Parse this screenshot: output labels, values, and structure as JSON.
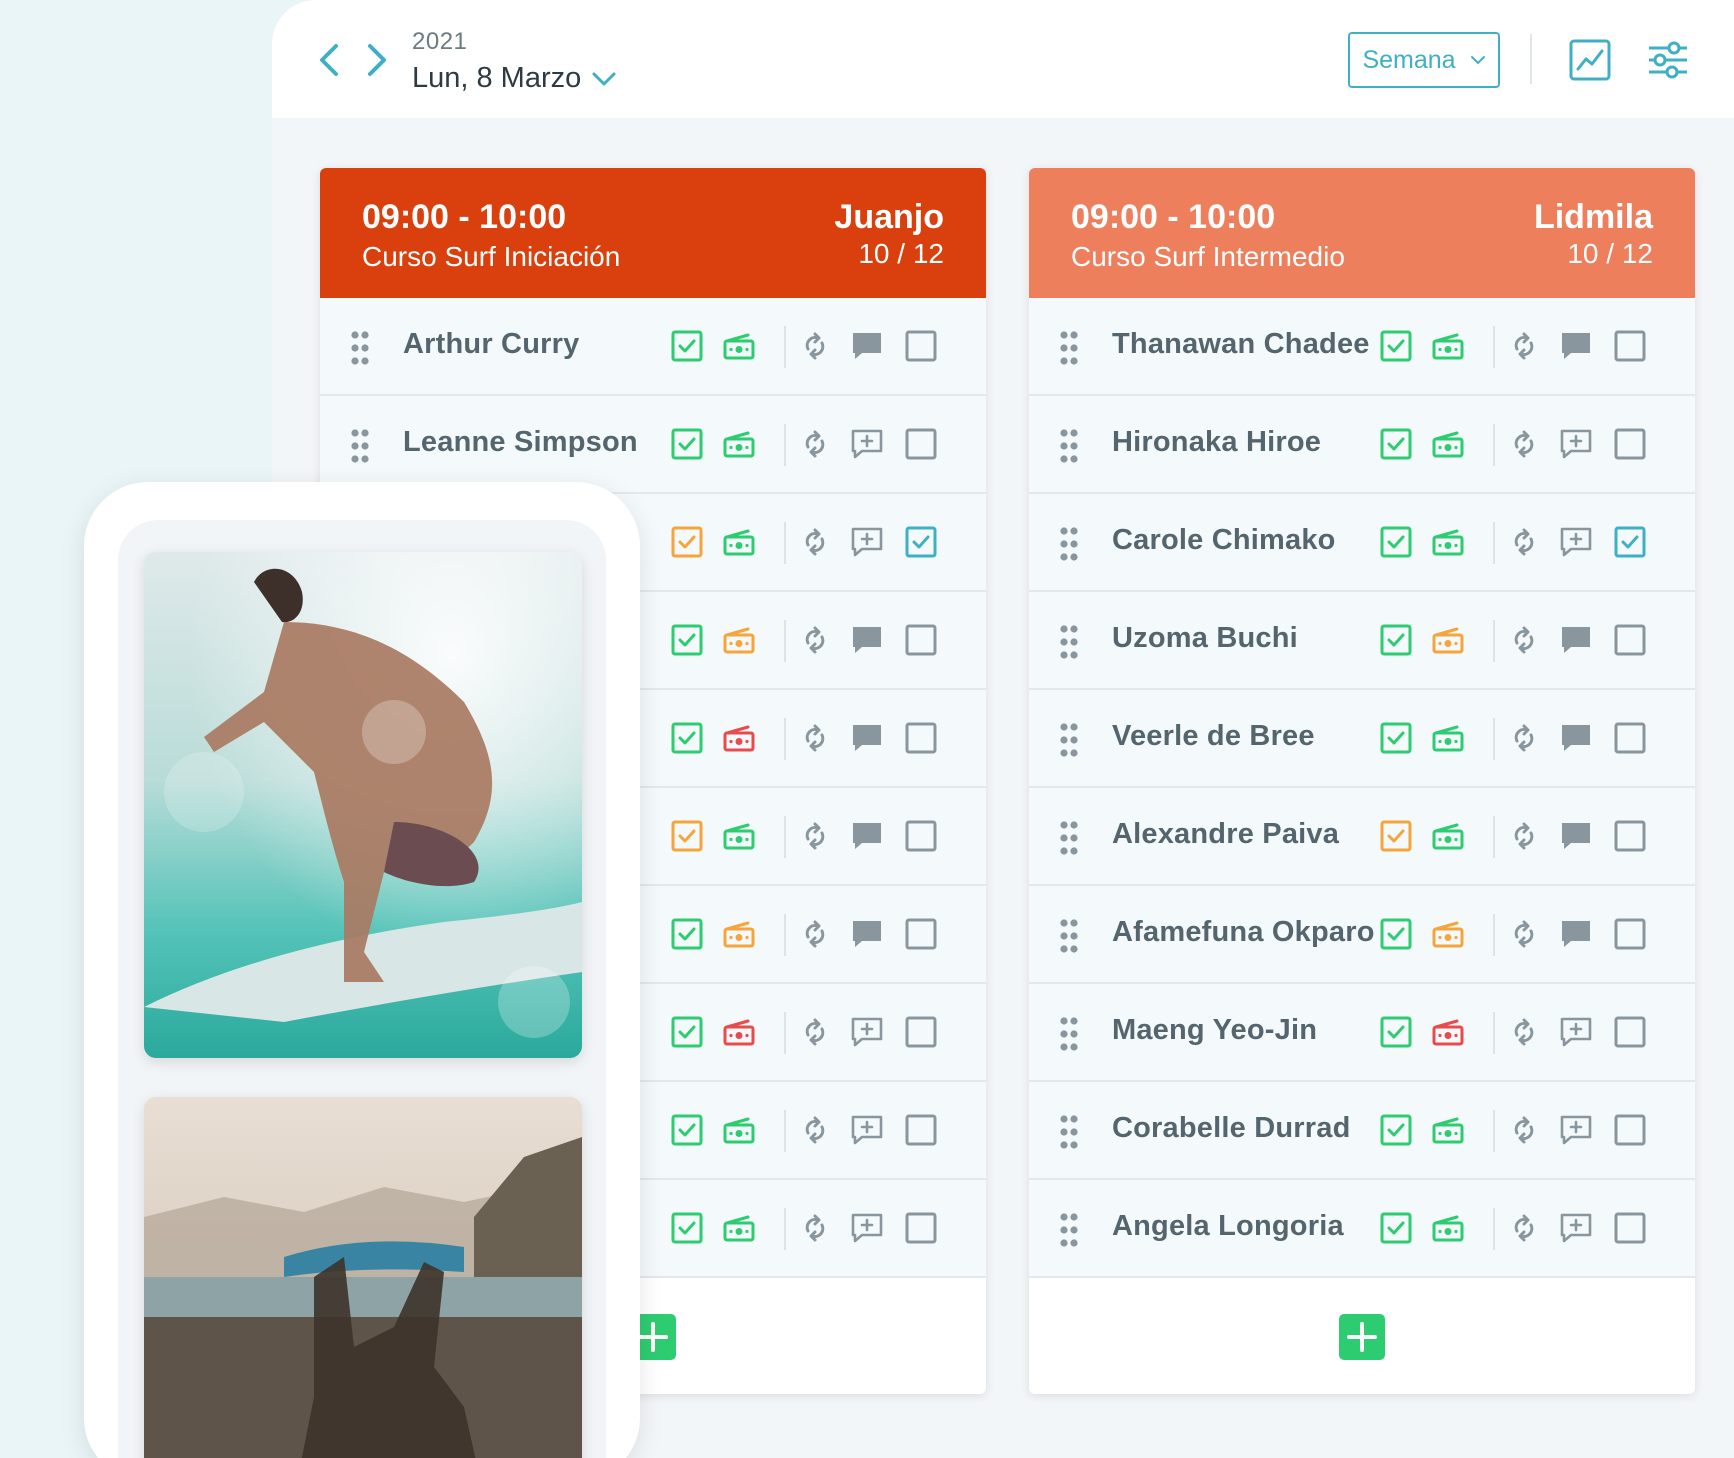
{
  "header": {
    "year": "2021",
    "date": "Lun, 8 Marzo",
    "view_select": "Semana",
    "icons": [
      "chevron-left-icon",
      "chevron-right-icon",
      "chevron-down-icon",
      "chart-icon",
      "filter-sliders-icon"
    ]
  },
  "colors": {
    "accent": "#3fb0c4",
    "card1_header": "#d9400d",
    "card2_header": "#ee7f5c",
    "green": "#2ecc71",
    "orange": "#f5a53b",
    "red": "#e84b4b",
    "gray_icon": "#8a969d"
  },
  "sessions": [
    {
      "time": "09:00 - 10:00",
      "course": "Curso Surf Iniciación",
      "instructor": "Juanjo",
      "count": "10 / 12",
      "students": [
        {
          "name": "Arthur Curry",
          "attendance": "green",
          "payment": "green",
          "comment": "filled",
          "checked": false
        },
        {
          "name": "Leanne Simpson",
          "attendance": "green",
          "payment": "green",
          "comment": "add",
          "checked": false
        },
        {
          "name": "",
          "attendance": "orange",
          "payment": "green",
          "comment": "add",
          "checked": true
        },
        {
          "name": "",
          "attendance": "green",
          "payment": "orange",
          "comment": "filled",
          "checked": false
        },
        {
          "name": "",
          "attendance": "green",
          "payment": "red",
          "comment": "filled",
          "checked": false
        },
        {
          "name": "",
          "attendance": "orange",
          "payment": "green",
          "comment": "filled",
          "checked": false
        },
        {
          "name": "",
          "attendance": "green",
          "payment": "orange",
          "comment": "filled",
          "checked": false
        },
        {
          "name": "",
          "attendance": "green",
          "payment": "red",
          "comment": "add",
          "checked": false
        },
        {
          "name": "",
          "attendance": "green",
          "payment": "green",
          "comment": "add",
          "checked": false
        },
        {
          "name": "",
          "attendance": "green",
          "payment": "green",
          "comment": "add",
          "checked": false
        }
      ]
    },
    {
      "time": "09:00 - 10:00",
      "course": "Curso Surf Intermedio",
      "instructor": "Lidmila",
      "count": "10 / 12",
      "students": [
        {
          "name": "Thanawan Chadee",
          "attendance": "green",
          "payment": "green",
          "comment": "filled",
          "checked": false
        },
        {
          "name": "Hironaka Hiroe",
          "attendance": "green",
          "payment": "green",
          "comment": "add",
          "checked": false
        },
        {
          "name": "Carole Chimako",
          "attendance": "green",
          "payment": "green",
          "comment": "add",
          "checked": true
        },
        {
          "name": "Uzoma Buchi",
          "attendance": "green",
          "payment": "orange",
          "comment": "filled",
          "checked": false
        },
        {
          "name": "Veerle de Bree",
          "attendance": "green",
          "payment": "green",
          "comment": "filled",
          "checked": false
        },
        {
          "name": "Alexandre Paiva",
          "attendance": "orange",
          "payment": "green",
          "comment": "filled",
          "checked": false
        },
        {
          "name": "Afamefuna Okparo",
          "attendance": "green",
          "payment": "orange",
          "comment": "filled",
          "checked": false
        },
        {
          "name": "Maeng Yeo-Jin",
          "attendance": "green",
          "payment": "red",
          "comment": "add",
          "checked": false
        },
        {
          "name": "Corabelle Durrad",
          "attendance": "green",
          "payment": "green",
          "comment": "add",
          "checked": false
        },
        {
          "name": "Angela Longoria",
          "attendance": "green",
          "payment": "green",
          "comment": "add",
          "checked": false
        }
      ]
    }
  ]
}
